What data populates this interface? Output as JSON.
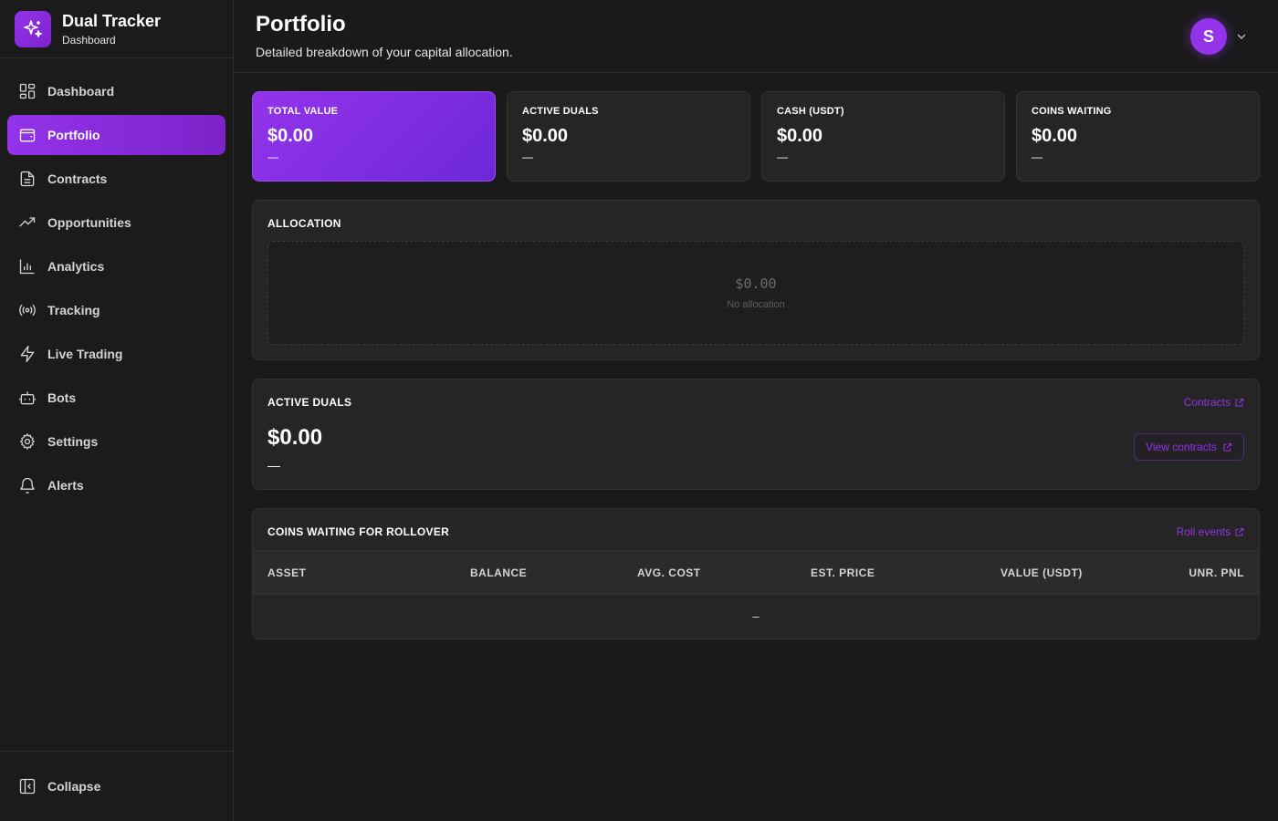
{
  "app": {
    "title": "Dual Tracker",
    "subtitle": "Dashboard",
    "logo_icon": "sparkles-icon",
    "accent": "#9333ea"
  },
  "sidebar": {
    "items": [
      {
        "label": "Dashboard",
        "icon": "grid-icon",
        "active": false
      },
      {
        "label": "Portfolio",
        "icon": "wallet-icon",
        "active": true
      },
      {
        "label": "Contracts",
        "icon": "document-icon",
        "active": false
      },
      {
        "label": "Opportunities",
        "icon": "trending-up-icon",
        "active": false
      },
      {
        "label": "Analytics",
        "icon": "bar-chart-icon",
        "active": false
      },
      {
        "label": "Tracking",
        "icon": "broadcast-icon",
        "active": false
      },
      {
        "label": "Live Trading",
        "icon": "lightning-icon",
        "active": false
      },
      {
        "label": "Bots",
        "icon": "bot-icon",
        "active": false
      },
      {
        "label": "Settings",
        "icon": "gear-icon",
        "active": false
      },
      {
        "label": "Alerts",
        "icon": "bell-icon",
        "active": false
      }
    ],
    "collapse_label": "Collapse"
  },
  "header": {
    "title": "Portfolio",
    "subtitle": "Detailed breakdown of your capital allocation.",
    "avatar_initial": "S"
  },
  "stats": [
    {
      "label": "TOTAL VALUE",
      "value": "$0.00",
      "sub": "—"
    },
    {
      "label": "ACTIVE DUALS",
      "value": "$0.00",
      "sub": "—"
    },
    {
      "label": "CASH (USDT)",
      "value": "$0.00",
      "sub": "—"
    },
    {
      "label": "COINS WAITING",
      "value": "$0.00",
      "sub": "—"
    }
  ],
  "allocation": {
    "title": "ALLOCATION",
    "value": "$0.00",
    "caption": "No allocation"
  },
  "active_duals": {
    "title": "ACTIVE DUALS",
    "link": "Contracts",
    "value": "$0.00",
    "sub": "—",
    "button": "View contracts"
  },
  "rollover": {
    "title": "COINS WAITING FOR ROLLOVER",
    "link": "Roll events",
    "columns": [
      "ASSET",
      "BALANCE",
      "AVG. COST",
      "EST. PRICE",
      "VALUE (USDT)",
      "UNR. PNL"
    ],
    "empty": "–"
  }
}
